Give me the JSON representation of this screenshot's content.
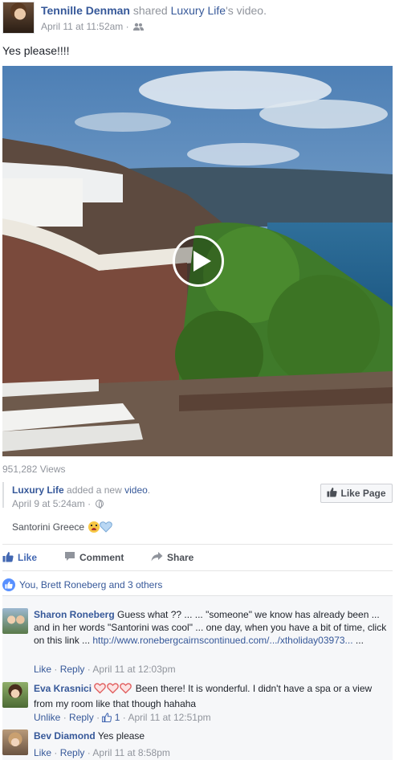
{
  "post": {
    "author": "Tennille Denman",
    "verb_shared": "shared",
    "page": "Luxury Life",
    "verb_tail": "'s video.",
    "timestamp": "April 11 at 11:52am",
    "separator": "·",
    "audience_icon": "friends-icon",
    "text": "Yes please!!!!"
  },
  "video": {
    "views": "951,282 Views",
    "play_icon": "play-icon"
  },
  "shared_post": {
    "page": "Luxury Life",
    "action_text": "added a new",
    "action_link": "video",
    "period": ".",
    "timestamp": "April 9 at 5:24am",
    "separator": "·",
    "privacy_icon": "globe-icon",
    "like_page_label": "Like Page",
    "text": "Santorini Greece"
  },
  "actions": {
    "like": "Like",
    "comment": "Comment",
    "share": "Share"
  },
  "likes_summary": "You, Brett Roneberg and 3 others",
  "comments": [
    {
      "name": "Sharon Roneberg",
      "text": "Guess what ?? ... ... \"someone\" we know has already been ... and in her words \"Santorini was cool\" ... one day, when you have a bit of time, click on this link ...",
      "link": "http://www.ronebergcairnscontinued.com/.../xtholiday03973...",
      "tail": "...",
      "like": "Like",
      "reply": "Reply",
      "time": "April 11 at 12:03pm",
      "dot": "·"
    },
    {
      "name": "Eva Krasnici",
      "text": "Been there! It is wonderful. I didn't have a spa or a view from my room like that though hahaha",
      "unlike": "Unlike",
      "reply": "Reply",
      "like_count": "1",
      "time": "April 11 at 12:51pm",
      "dot": "·"
    },
    {
      "name": "Bev Diamond",
      "text": "Yes please",
      "like": "Like",
      "reply": "Reply",
      "time": "April 11 at 8:58pm",
      "dot": "·"
    }
  ],
  "colors": {
    "link": "#365899",
    "muted": "#90949c",
    "like_blue": "#4267b2"
  }
}
